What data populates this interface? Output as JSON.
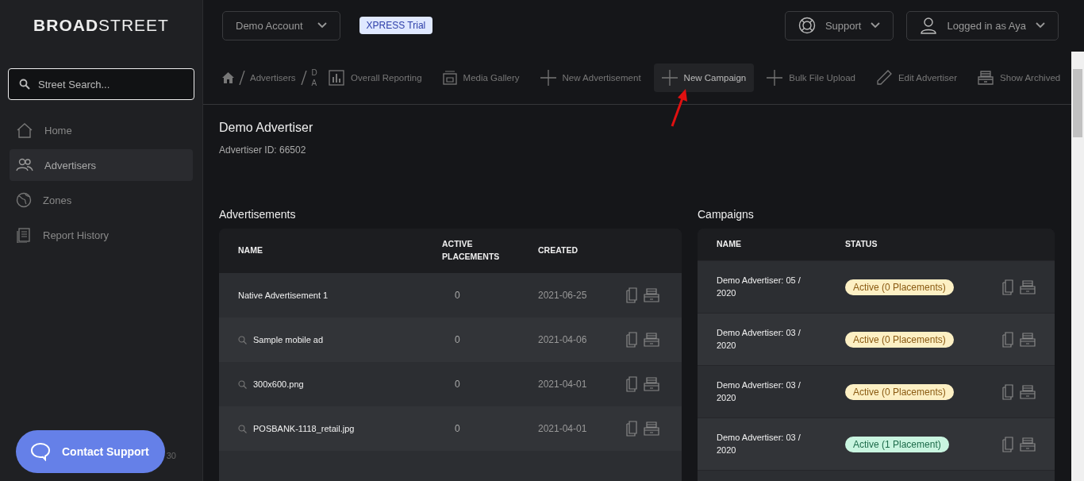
{
  "logo": {
    "bold": "BROAD",
    "light": "STREET"
  },
  "search": {
    "placeholder": "Street Search..."
  },
  "nav": [
    {
      "label": "Home",
      "selected": false
    },
    {
      "label": "Advertisers",
      "selected": true
    },
    {
      "label": "Zones",
      "selected": false
    },
    {
      "label": "Report History",
      "selected": false
    }
  ],
  "version": "30",
  "contact_support": "Contact Support",
  "account": "Demo Account",
  "trial_badge": "XPRESS Trial",
  "support": "Support",
  "user": "Logged in as Aya",
  "breadcrumb": [
    "Advertisers",
    "D A"
  ],
  "toolbar": [
    {
      "label": "Overall Reporting",
      "selected": false
    },
    {
      "label": "Media Gallery",
      "selected": false
    },
    {
      "label": "New Advertisement",
      "selected": false
    },
    {
      "label": "New Campaign",
      "selected": true
    },
    {
      "label": "Bulk File Upload",
      "selected": false
    },
    {
      "label": "Edit Advertiser",
      "selected": false
    },
    {
      "label": "Show Archived",
      "selected": false
    }
  ],
  "advertiser": {
    "name": "Demo Advertiser",
    "id": "Advertiser ID: 66502"
  },
  "advertisements": {
    "title": "Advertisements",
    "columns": [
      "NAME",
      "ACTIVE PLACEMENTS",
      "CREATED"
    ],
    "rows": [
      {
        "name": "Native Advertisement 1",
        "preview": false,
        "placements": "0",
        "created": "2021-06-25"
      },
      {
        "name": "Sample mobile ad",
        "preview": true,
        "placements": "0",
        "created": "2021-04-06"
      },
      {
        "name": "300x600.png",
        "preview": true,
        "placements": "0",
        "created": "2021-04-01"
      },
      {
        "name": "POSBANK-1118_retail.jpg",
        "preview": true,
        "placements": "0",
        "created": "2021-04-01"
      }
    ]
  },
  "campaigns": {
    "title": "Campaigns",
    "columns": [
      "NAME",
      "STATUS"
    ],
    "rows": [
      {
        "name": "Demo Advertiser: 05 / 2020",
        "status": "Active (0 Placements)",
        "color": "#fdf0c4"
      },
      {
        "name": "Demo Advertiser: 03 / 2020",
        "status": "Active (0 Placements)",
        "color": "#fdf0c4"
      },
      {
        "name": "Demo Advertiser: 03 / 2020",
        "status": "Active (0 Placements)",
        "color": "#fdf0c4"
      },
      {
        "name": "Demo Advertiser: 03 / 2020",
        "status": "Active (1 Placement)",
        "color": "#c9f5e0"
      }
    ]
  }
}
